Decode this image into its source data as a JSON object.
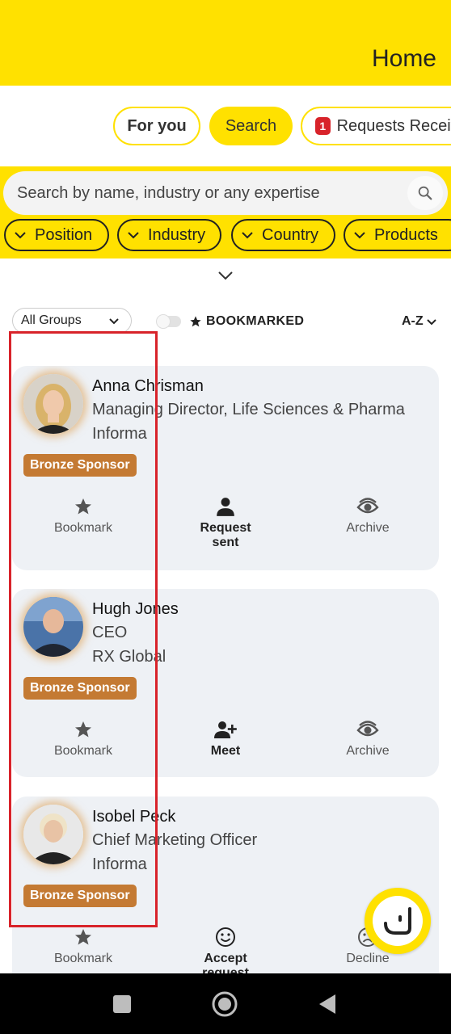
{
  "header": {
    "title": "Home"
  },
  "tabs": {
    "for_you": "For you",
    "search": "Search",
    "requests_badge": "1",
    "requests": "Requests Received"
  },
  "search": {
    "placeholder": "Search by name, industry or any expertise"
  },
  "filters": [
    "Position",
    "Industry",
    "Country",
    "Products"
  ],
  "list_controls": {
    "group_select": "All Groups",
    "bookmarked_label": "BOOKMARKED",
    "bookmarked_on": false,
    "sort": "A-Z"
  },
  "cards": [
    {
      "name": "Anna Chrisman",
      "title": "Managing Director, Life Sciences & Pharma",
      "company": "Informa",
      "badge": "Bronze Sponsor",
      "actions": [
        {
          "icon": "star-icon",
          "label": "Bookmark"
        },
        {
          "icon": "person-icon",
          "label": "Request sent"
        },
        {
          "icon": "eye-icon",
          "label": "Archive"
        }
      ]
    },
    {
      "name": "Hugh Jones",
      "title": "CEO",
      "company": "RX Global",
      "badge": "Bronze Sponsor",
      "actions": [
        {
          "icon": "star-icon",
          "label": "Bookmark"
        },
        {
          "icon": "add-person-icon",
          "label": "Meet"
        },
        {
          "icon": "eye-icon",
          "label": "Archive"
        }
      ]
    },
    {
      "name": "Isobel Peck",
      "title": "Chief Marketing Officer",
      "company": "Informa",
      "badge": "Bronze Sponsor",
      "actions": [
        {
          "icon": "star-icon",
          "label": "Bookmark"
        },
        {
          "icon": "smile-icon",
          "label": "Accept request"
        },
        {
          "icon": "frown-icon",
          "label": "Decline"
        }
      ]
    }
  ],
  "colors": {
    "brand_yellow": "#ffe100",
    "badge_bronze": "#c47a33",
    "highlight_red": "#d8232a",
    "card_bg": "#eef1f5"
  }
}
